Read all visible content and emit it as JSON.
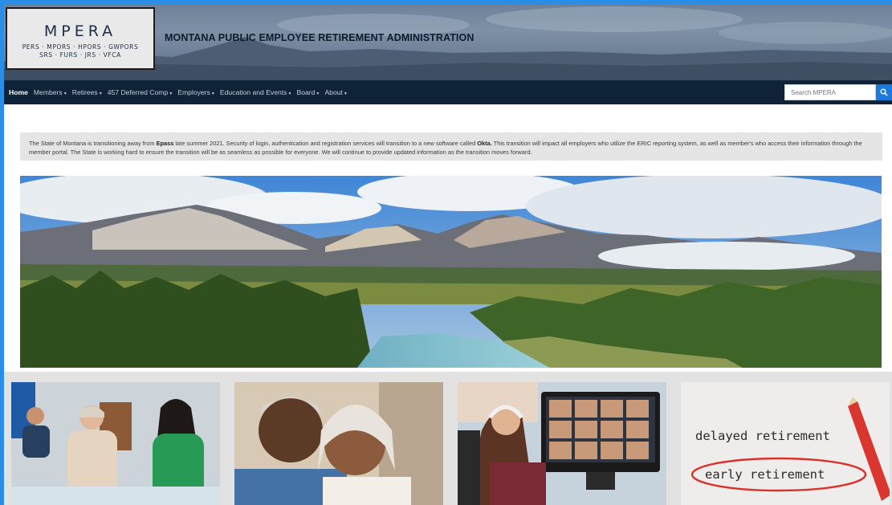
{
  "header": {
    "logo": {
      "name": "MPERA",
      "line1": "PERS · MPORS · HPORS · GWPORS",
      "line2": "SRS · FURS · JRS · VFCA"
    },
    "title": "MONTANA PUBLIC EMPLOYEE RETIREMENT ADMINISTRATION"
  },
  "nav": {
    "items": [
      {
        "label": "Home",
        "caret": false,
        "active": true
      },
      {
        "label": "Members",
        "caret": true
      },
      {
        "label": "Retirees",
        "caret": true
      },
      {
        "label": "457 Deferred Comp",
        "caret": true
      },
      {
        "label": "Employers",
        "caret": true
      },
      {
        "label": "Education and Events",
        "caret": true
      },
      {
        "label": "Board",
        "caret": true
      },
      {
        "label": "About",
        "caret": true
      }
    ],
    "search_placeholder": "Search MPERA"
  },
  "alert": {
    "p1": "The State of Montana is transitioning away from ",
    "b1": "Epass",
    "p2": " late summer 2021. Security of login, authentication and registration services will transition to a new software called ",
    "b2": "Okta.",
    "p3": " This transition will impact all employers who utilize the ERIC reporting system, as well as member's who access their information through the member portal. The State is working hard to ensure the transition will be as seamless as possible for everyone. We will continue to provide updated information as the transition moves forward."
  },
  "cards": {
    "card4_line1": "delayed retirement",
    "card4_line2": "early retirement"
  },
  "colors": {
    "nav_bg": "#0e2238",
    "accent": "#1a7ae0",
    "frame": "#2b8ee6"
  }
}
